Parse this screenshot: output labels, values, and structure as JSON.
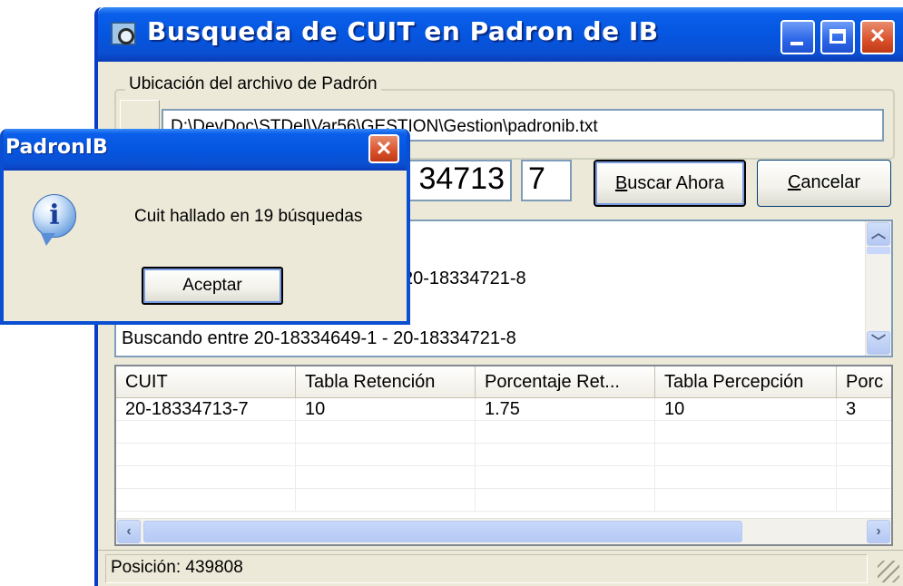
{
  "main_window": {
    "title": "Busqueda de CUIT en Padron de IB",
    "group_label": "Ubicación del archivo de Padrón",
    "file_path": "D:\\DevDoc\\STDel\\Var56\\GESTION\\Gestion\\padronib.txt",
    "cuit_value": "34713",
    "check_digit_value": "7",
    "search_button": {
      "accel": "B",
      "rest": "uscar Ahora"
    },
    "cancel_button": {
      "accel": "C",
      "rest": "ancelar"
    },
    "log_lines": [
      "20-18334721-8",
      "Buscando entre 20-18334649-1 - 20-18334721-8"
    ],
    "grid": {
      "columns": [
        "CUIT",
        "Tabla Retención",
        "Porcentaje Ret...",
        "Tabla Percepción",
        "Porc"
      ],
      "rows": [
        [
          "20-18334713-7",
          "10",
          "1.75",
          "10",
          "3"
        ]
      ]
    },
    "status_text": "Posición: 439808"
  },
  "message_box": {
    "title": "PadronIB",
    "message": "Cuit hallado en 19 búsquedas",
    "ok_label": "Aceptar",
    "icon": "info-icon"
  },
  "theme": {
    "titlebar_blue": "#0556E0",
    "window_face": "#ECE9D8",
    "close_red": "#D9512B"
  }
}
